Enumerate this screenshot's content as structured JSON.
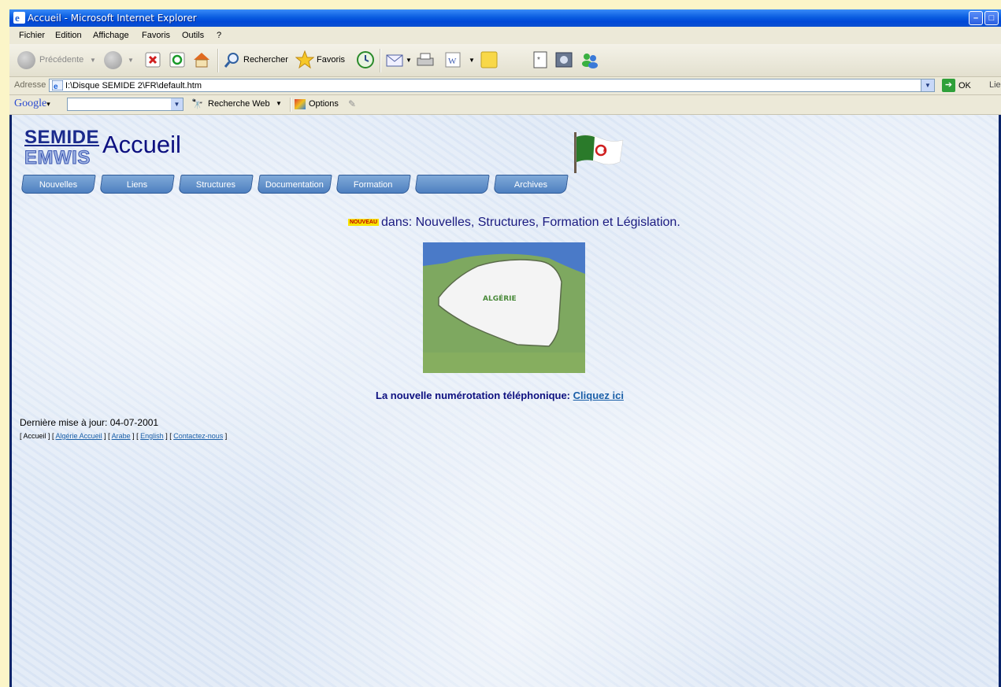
{
  "window": {
    "title": "Accueil - Microsoft Internet Explorer"
  },
  "menubar": {
    "items": [
      "Fichier",
      "Edition",
      "Affichage",
      "Favoris",
      "Outils",
      "?"
    ]
  },
  "toolbar": {
    "back_label": "Précédente",
    "search_label": "Rechercher",
    "favorites_label": "Favoris"
  },
  "address": {
    "label": "Adresse",
    "url": "I:\\Disque SEMIDE 2\\FR\\default.htm",
    "go_label": "OK",
    "links_label": "Lie"
  },
  "google": {
    "logo": "Google",
    "search_value": "",
    "web_search_label": "Recherche Web",
    "options_label": "Options"
  },
  "page": {
    "logo_top": "SEMIDE",
    "logo_bottom": "EMWIS",
    "title": "Accueil",
    "nav": [
      "Nouvelles",
      "Liens",
      "Structures",
      "Documentation",
      "Formation",
      "",
      "Archives"
    ],
    "new_badge": "NOUVEAU",
    "news_text": "dans: Nouvelles, Structures, Formation et Législation.",
    "map_label": "ALGÉRIE",
    "phone_text": "La nouvelle numérotation téléphonique:",
    "phone_link": "Cliquez ici",
    "update_text": "Dernière mise à jour: 04-07-2001",
    "footer": {
      "current": "Accueil",
      "links": [
        "Algérie Accueil",
        "Arabe",
        "English",
        "Contactez-nous"
      ]
    }
  },
  "colors": {
    "title_blue": "#0d1080",
    "link_blue": "#1a5fa8",
    "nav_blue": "#5b8bc9",
    "xp_titlebar": "#0a5de0"
  }
}
